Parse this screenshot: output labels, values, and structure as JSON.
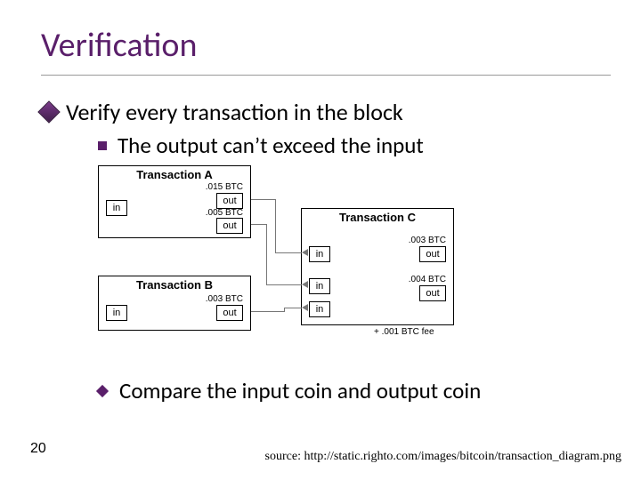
{
  "title": "Verification",
  "bullets": {
    "b1": "Verify every transaction in the block",
    "b2": "The output can’t exceed the input",
    "b3": "Compare the input coin and output coin"
  },
  "diagram": {
    "txA": {
      "title": "Transaction A",
      "in": "in",
      "out": "out",
      "amt1": ".015 BTC",
      "amt2": ".005 BTC"
    },
    "txB": {
      "title": "Transaction B",
      "in": "in",
      "out": "out",
      "amt1": ".003 BTC"
    },
    "txC": {
      "title": "Transaction C",
      "in": "in",
      "out": "out",
      "amt1": ".003 BTC",
      "amt2": ".004 BTC",
      "fee": "+ .001 BTC fee"
    }
  },
  "page_number": "20",
  "source_text": "source: http://static.righto.com/images/bitcoin/transaction_diagram.png"
}
